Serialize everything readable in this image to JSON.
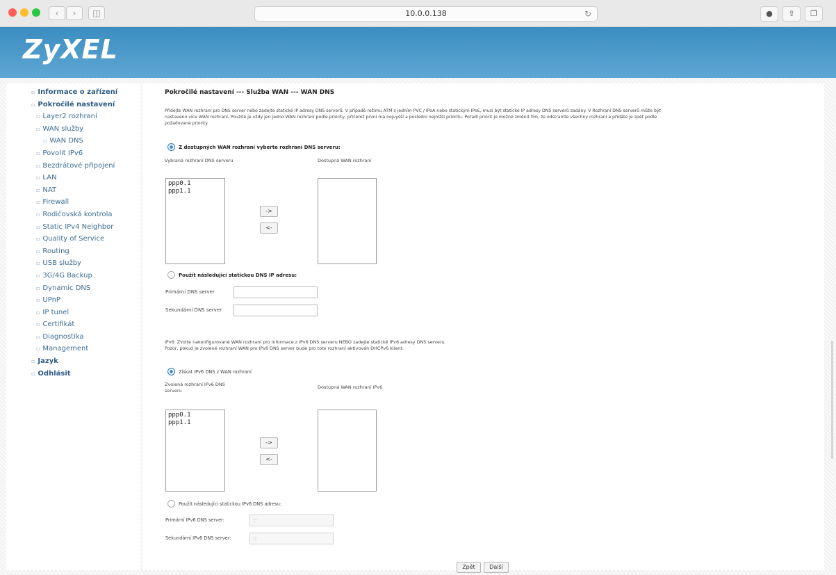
{
  "browser": {
    "url": "10.0.0.138",
    "back_icon": "chevron-left-icon",
    "forward_icon": "chevron-right-icon",
    "sidebar_icon": "sidebar-icon",
    "reload_icon": "reload-icon",
    "download_icon": "download-icon",
    "share_icon": "share-icon",
    "tabs_icon": "tabs-icon"
  },
  "brand": {
    "logo": "ZyXEL",
    "header_color": "#4a9acb"
  },
  "sidebar": {
    "items": [
      {
        "label": "Informace o zařízení"
      },
      {
        "label": "Pokročilé nastavení"
      },
      {
        "label": "Layer2 rozhraní"
      },
      {
        "label": "WAN služby"
      },
      {
        "label": "WAN DNS"
      },
      {
        "label": "Povolit IPv6"
      },
      {
        "label": "Bezdrátové připojení"
      },
      {
        "label": "LAN"
      },
      {
        "label": "NAT"
      },
      {
        "label": "Firewall"
      },
      {
        "label": "Rodičovská kontrola"
      },
      {
        "label": "Static IPv4 Neighbor"
      },
      {
        "label": "Quality of Service"
      },
      {
        "label": "Routing"
      },
      {
        "label": "USB služby"
      },
      {
        "label": "3G/4G Backup"
      },
      {
        "label": "Dynamic DNS"
      },
      {
        "label": "UPnP"
      },
      {
        "label": "IP tunel"
      },
      {
        "label": "Certifikát"
      },
      {
        "label": "Diagnostika"
      },
      {
        "label": "Management"
      },
      {
        "label": "Jazyk"
      },
      {
        "label": "Odhlásit"
      }
    ]
  },
  "page": {
    "title": "Pokročilé nastavení --- Služba WAN --- WAN DNS",
    "desc_line1": "Přidejte WAN rozhraní pro DNS server nebo zadejte statické IP adresy DNS serverů. V případě režimu ATM s jedním PVC / IPoA nebo statickým IPoE, musí být statické IP adresy DNS serverů zadány. V Rozhraní DNS serverů může být",
    "desc_line2": "nastaveno více WAN rozhraní. Použité je vždy jen jedno WAN rozhraní podle priority, přičemž první má nejvyšší a poslední nejnižší prioritu. Pořadí priorit je možné změnit tím, že odstraníte všechny rozhraní a přidáte je zpět podle",
    "desc_line3": "požadované priority.",
    "ipv4": {
      "radio_dynamic_label": "Z dostupných WAN rozhraní vyberte rozhraní DNS serveru:",
      "selected_label": "Vybraná rozhraní DNS serveru",
      "available_label": "Dostupná WAN rozhraní",
      "selected_items": [
        "ppp0.1",
        "ppp1.1"
      ],
      "add_button": "->",
      "remove_button": "<-",
      "radio_static_label": "Použít následující statickou DNS IP adresu:",
      "primary_label": "Primární DNS server",
      "secondary_label": "Sekundární DNS server",
      "primary_value": "",
      "secondary_value": ""
    },
    "ipv6": {
      "note_line1": "IPv6: Zvolte nakonfigurované WAN rozhraní pro informace z IPv6 DNS serveru NEBO zadejte statické IPv6 adresy DNS serveru.",
      "note_line2": "Pozor, pokud je zvolené rozhraní WAN pro IPv6 DNS server bude pro toto rozhraní aktivován DHCPv6 klient.",
      "radio_dynamic_label": "Získat IPv6 DNS z WAN rozhraní",
      "selected_label_1": "Zvolená rozhraní IPv6 DNS",
      "selected_label_2": "serveru",
      "available_label": "Dostupná WAN rozhraní IPv6",
      "selected_items": [
        "ppp0.1",
        "ppp1.1"
      ],
      "add_button": "->",
      "remove_button": "<-",
      "radio_static_label": "Použít následující statickou IPv6 DNS adresu:",
      "primary_label": "Primární IPv6 DNS server:",
      "secondary_label": "Sekundární IPv6 DNS server:",
      "primary_value": "::",
      "secondary_value": "::"
    },
    "back_button": "Zpět",
    "next_button": "Další"
  }
}
